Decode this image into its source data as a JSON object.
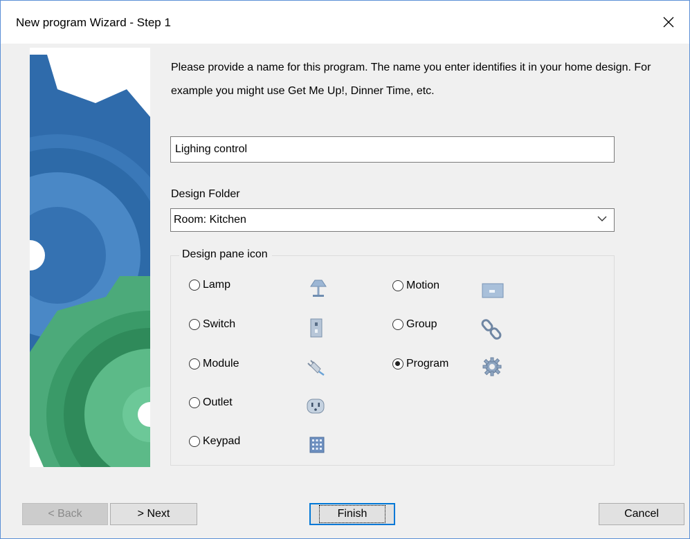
{
  "window": {
    "title": "New program Wizard - Step 1",
    "close_glyph": "✕"
  },
  "description": "Please provide a name for this program.  The name you enter identifies it in your home design.  For example you might use Get Me Up!, Dinner Time, etc.",
  "program_name": {
    "value": "Lighing control"
  },
  "design_folder": {
    "label": "Design Folder",
    "selected": "Room: Kitchen"
  },
  "design_pane_icon": {
    "label": "Design pane icon",
    "options": [
      {
        "label": "Lamp",
        "icon": "lamp-icon",
        "checked": false
      },
      {
        "label": "Switch",
        "icon": "switch-icon",
        "checked": false
      },
      {
        "label": "Module",
        "icon": "plug-icon",
        "checked": false
      },
      {
        "label": "Outlet",
        "icon": "outlet-icon",
        "checked": false
      },
      {
        "label": "Keypad",
        "icon": "keypad-icon",
        "checked": false
      },
      {
        "label": "Motion",
        "icon": "motion-sensor-icon",
        "checked": false
      },
      {
        "label": "Group",
        "icon": "chain-link-icon",
        "checked": false
      },
      {
        "label": "Program",
        "icon": "gear-icon",
        "checked": true
      }
    ]
  },
  "buttons": {
    "back": "< Back",
    "next": "> Next",
    "finish": "Finish",
    "cancel": "Cancel"
  },
  "colors": {
    "banner_blue": "#2f6fae",
    "banner_green": "#3a9a6a",
    "focus_blue": "#0078d7"
  }
}
